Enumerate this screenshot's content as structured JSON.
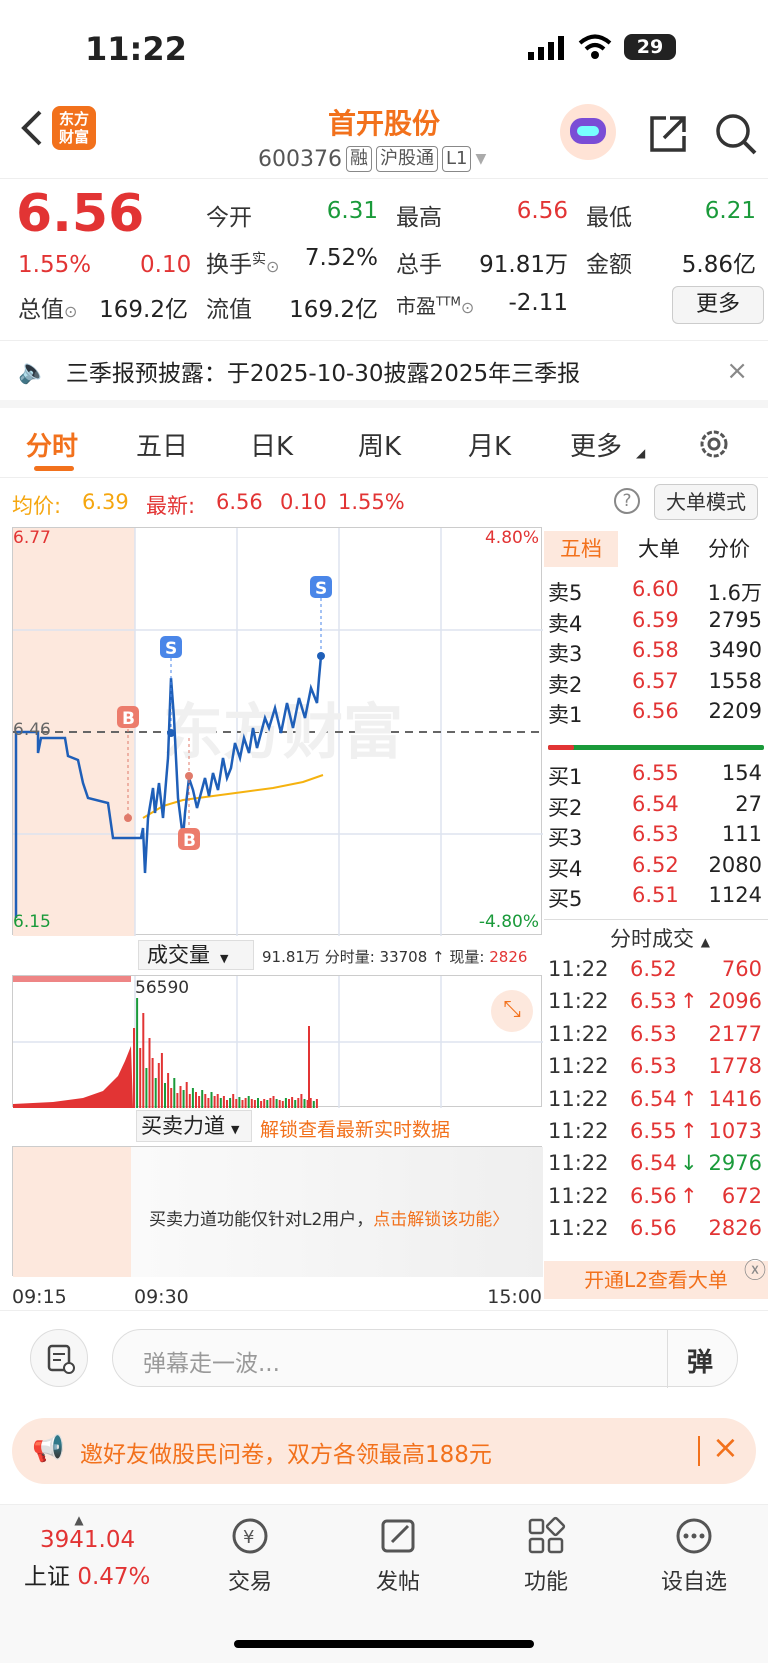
{
  "status": {
    "time": "11:22",
    "battery": "29"
  },
  "header": {
    "logo": "东方\n财富",
    "title": "首开股份",
    "code": "600376",
    "tags": [
      "融",
      "沪股通",
      "L1"
    ]
  },
  "quote": {
    "price": "6.56",
    "pct": "1.55%",
    "chg": "0.10",
    "open_l": "今开",
    "open": "6.31",
    "high_l": "最高",
    "high": "6.56",
    "low_l": "最低",
    "low": "6.21",
    "turn_l": "换手",
    "turn_sup": "实",
    "turn": "7.52%",
    "vol_l": "总手",
    "vol": "91.81万",
    "amt_l": "金额",
    "amt": "5.86亿",
    "mcap_l": "总值",
    "mcap": "169.2亿",
    "fcap_l": "流值",
    "fcap": "169.2亿",
    "pe_l": "市盈",
    "pe_sup": "TTM",
    "pe": "-2.11",
    "more": "更多"
  },
  "notice": {
    "text": "三季报预披露：于2025-10-30披露2025年三季报"
  },
  "tabs": [
    "分时",
    "五日",
    "日K",
    "周K",
    "月K",
    "更多"
  ],
  "legend": {
    "avg_l": "均价:",
    "avg": "6.39",
    "latest_l": "最新:",
    "latest": "6.56",
    "chg": "0.10",
    "pct": "1.55%",
    "mode": "大单模式"
  },
  "chart": {
    "ymax": "6.77",
    "ymin": "6.15",
    "mid": "6.46",
    "pmax": "4.80%",
    "pmin": "-4.80%",
    "watermark": "东方财富",
    "t0": "09:15",
    "t1": "09:30",
    "t2": "15:00",
    "sell_marker": "S",
    "buy_marker": "B"
  },
  "volume": {
    "select": "成交量",
    "info1": "91.81万",
    "info2": "分时量: 33708",
    "info3": "现量:",
    "info4": "2826",
    "peak": "56590"
  },
  "bsforce": {
    "select": "买卖力道",
    "unlock": "解锁查看最新实时数据",
    "msg": "买卖力道功能仅针对L2用户，",
    "link": "点击解锁该功能"
  },
  "orderbook": {
    "tabs": [
      "五档",
      "大单",
      "分价"
    ],
    "asks": [
      [
        "卖5",
        "6.60",
        "1.6万"
      ],
      [
        "卖4",
        "6.59",
        "2795"
      ],
      [
        "卖3",
        "6.58",
        "3490"
      ],
      [
        "卖2",
        "6.57",
        "1558"
      ],
      [
        "卖1",
        "6.56",
        "2209"
      ]
    ],
    "bids": [
      [
        "买1",
        "6.55",
        "154"
      ],
      [
        "买2",
        "6.54",
        "27"
      ],
      [
        "买3",
        "6.53",
        "111"
      ],
      [
        "买4",
        "6.52",
        "2080"
      ],
      [
        "买5",
        "6.51",
        "1124"
      ]
    ]
  },
  "ticks": {
    "title": "分时成交",
    "rows": [
      [
        "11:22",
        "6.52",
        "",
        "760",
        "red"
      ],
      [
        "11:22",
        "6.53",
        "↑",
        "2096",
        "red"
      ],
      [
        "11:22",
        "6.53",
        "",
        "2177",
        "red"
      ],
      [
        "11:22",
        "6.53",
        "",
        "1778",
        "red"
      ],
      [
        "11:22",
        "6.54",
        "↑",
        "1416",
        "red"
      ],
      [
        "11:22",
        "6.55",
        "↑",
        "1073",
        "red"
      ],
      [
        "11:22",
        "6.54",
        "↓",
        "2976",
        "green"
      ],
      [
        "11:22",
        "6.56",
        "↑",
        "672",
        "red"
      ],
      [
        "11:22",
        "6.56",
        "",
        "2826",
        "red"
      ]
    ],
    "l2": "开通L2查看大单"
  },
  "comment": {
    "placeholder": "弹幕走一波...",
    "btn": "弹"
  },
  "banner": {
    "text": "邀好友做股民问卷，双方各领最高188元"
  },
  "bottom": {
    "index": "3941.04",
    "index_name": "上证",
    "index_pct": "0.47%",
    "nav": [
      "交易",
      "发帖",
      "功能",
      "设自选"
    ]
  },
  "colors": {
    "red": "#e23434",
    "green": "#1a9a3a",
    "accent": "#f2711c",
    "avg_line": "#f5b20f",
    "price_line": "#1f5fb8"
  }
}
